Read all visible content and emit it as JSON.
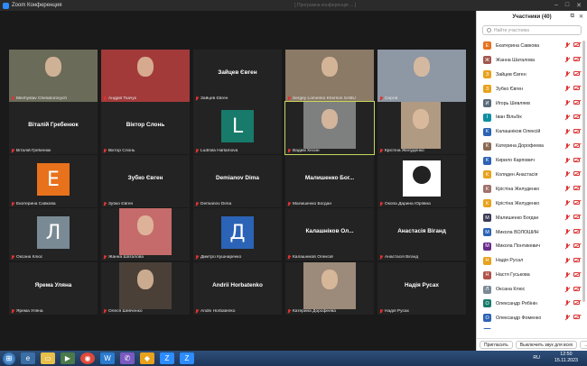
{
  "window": {
    "title": "Zoom Конференция",
    "faint_text": "[ Програмна конференція ... ]"
  },
  "tiles": [
    {
      "name": "Mechyslav Cheluborovych",
      "kind": "video",
      "bg": "#6b6b5a"
    },
    {
      "name": "Андрій Ткачук",
      "kind": "video",
      "bg": "#a23a3a"
    },
    {
      "name": "Зайцев Євген",
      "kind": "text",
      "label": "Зайцев Євген"
    },
    {
      "name": "Sergey Lomenko Kherson SABU",
      "kind": "video",
      "bg": "#8a7a66"
    },
    {
      "name": "Сергій",
      "kind": "video",
      "bg": "#8e97a4"
    },
    {
      "name": "Віталій Гребенюк",
      "kind": "text",
      "label": "Віталій Гребенюк"
    },
    {
      "name": "Віктор Слонь",
      "kind": "text",
      "label": "Віктор Слонь"
    },
    {
      "name": "Ludmila Harlamova",
      "kind": "avatar",
      "letter": "L",
      "color": "#177a6a"
    },
    {
      "name": "Вадим Хесин",
      "kind": "video",
      "bg": "#7d807f",
      "highlight": true
    },
    {
      "name": "Крістіна Желуденко",
      "kind": "video",
      "bg": "#b09a82"
    },
    {
      "name": "Екатерина Савкова",
      "kind": "avatar",
      "letter": "Е",
      "color": "#e8711c"
    },
    {
      "name": "Зубко Євген",
      "kind": "text",
      "label": "Зубко Євген"
    },
    {
      "name": "Demianov Dima",
      "kind": "text",
      "label": "Demianov Dima"
    },
    {
      "name": "Малишенко Богдан",
      "kind": "text",
      "label": "Малишенко Бог..."
    },
    {
      "name": "Окопа Дарина Юріївна",
      "kind": "photo",
      "bg": "#ffffff"
    },
    {
      "name": "Оксана Клюс",
      "kind": "avatar",
      "letter": "Л",
      "color": "#7a8a95"
    },
    {
      "name": "Жанна Шаталова",
      "kind": "video",
      "bg": "#c56b6b"
    },
    {
      "name": "Дмитро Кушнаренко",
      "kind": "avatar",
      "letter": "Д",
      "color": "#2b63b6"
    },
    {
      "name": "Калашніков Олексій",
      "kind": "text",
      "label": "Калашніков Ол..."
    },
    {
      "name": "Анастасія Віганд",
      "kind": "text",
      "label": "Анастасія Віганд"
    },
    {
      "name": "Ярема Уляна",
      "kind": "text",
      "label": "Ярема Уляна"
    },
    {
      "name": "Олеся Шевченко",
      "kind": "video",
      "bg": "#4a4038"
    },
    {
      "name": "Andrii Horbatenko",
      "kind": "text",
      "label": "Andrii Horbatenko"
    },
    {
      "name": "Катерина Дорофеева",
      "kind": "video",
      "bg": "#9c8a7a"
    },
    {
      "name": "Надія Русах",
      "kind": "text",
      "label": "Надія Русах"
    }
  ],
  "panel": {
    "title": "Участники (40)",
    "search_placeholder": "Найти участника",
    "invite": "Пригласить",
    "mute_all": "Выключить звук для всех",
    "more": "...",
    "participants": [
      {
        "name": "Екатерина Савкова",
        "letter": "Е",
        "color": "#e8711c"
      },
      {
        "name": "Жанна Шаталова",
        "letter": "Ж",
        "color": "#a0574e"
      },
      {
        "name": "Зайцев Євген",
        "letter": "З",
        "color": "#e8a21c"
      },
      {
        "name": "Зубко Євген",
        "letter": "З",
        "color": "#e8a21c"
      },
      {
        "name": "Игорь Шевляев",
        "letter": "И",
        "color": "#5a6b7a"
      },
      {
        "name": "Іван Вільбік",
        "letter": "І",
        "color": "#0d8fa3"
      },
      {
        "name": "Калашніков Олексій",
        "letter": "К",
        "color": "#2b63b6"
      },
      {
        "name": "Катерина Дорофеева",
        "letter": "К",
        "color": "#8a6a55"
      },
      {
        "name": "Кирило Карпович",
        "letter": "К",
        "color": "#2b63b6"
      },
      {
        "name": "Коляден Анастасія",
        "letter": "К",
        "color": "#e8a21c"
      },
      {
        "name": "Крістіна Желуденко",
        "letter": "К",
        "color": "#a0726a"
      },
      {
        "name": "Крістіна Желуденко",
        "letter": "К",
        "color": "#e8a21c"
      },
      {
        "name": "Малишенко Богдан",
        "letter": "М",
        "color": "#3a3a55"
      },
      {
        "name": "Микола ВОЛОШИН",
        "letter": "М",
        "color": "#2b63b6"
      },
      {
        "name": "Микола Понтикевич",
        "letter": "М",
        "color": "#6b2b8a"
      },
      {
        "name": "Надія Русал",
        "letter": "Н",
        "color": "#e8a21c"
      },
      {
        "name": "Настя Гуськова",
        "letter": "Н",
        "color": "#b0524a"
      },
      {
        "name": "Оксана Клюс",
        "letter": "Л",
        "color": "#7a8a95"
      },
      {
        "name": "Олександр Рябінін",
        "letter": "О",
        "color": "#177a6a"
      },
      {
        "name": "Олександр Фоменко",
        "letter": "О",
        "color": "#2b63b6"
      },
      {
        "name": "Олександр Шапіков",
        "letter": "О",
        "color": "#2b63b6"
      }
    ]
  },
  "taskbar": {
    "lang": "RU",
    "time": "12:50",
    "date": "15.11.2023"
  }
}
